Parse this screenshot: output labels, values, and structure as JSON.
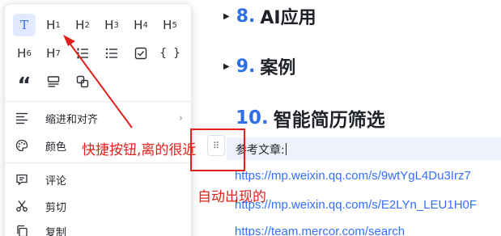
{
  "document": {
    "headings": [
      {
        "num": "8.",
        "text": "AI应用"
      },
      {
        "num": "9.",
        "text": "案例"
      },
      {
        "num": "10.",
        "text": "智能简历筛选"
      }
    ],
    "ref_label": "参考文章:",
    "links": [
      "https://mp.weixin.qq.com/s/9wtYgL4Du3Irz7",
      "https://mp.weixin.qq.com/s/E2LYn_LEU1H0F",
      "https://team.mercor.com/search"
    ]
  },
  "menu": {
    "row1": [
      {
        "label": "T",
        "sub": "",
        "icon": "text-icon"
      },
      {
        "label": "H",
        "sub": "1"
      },
      {
        "label": "H",
        "sub": "2"
      },
      {
        "label": "H",
        "sub": "3"
      },
      {
        "label": "H",
        "sub": "4"
      },
      {
        "label": "H",
        "sub": "5"
      }
    ],
    "row2": [
      {
        "label": "H",
        "sub": "6"
      },
      {
        "label": "H",
        "sub": "7"
      }
    ],
    "row2_icons": [
      "ordered-list-icon",
      "bullet-list-icon",
      "checkbox-icon",
      "code-braces-icon"
    ],
    "row2_glyphs": {
      "code": "{ }"
    },
    "row3_glyphs": {
      "quote": "“"
    },
    "items": {
      "indent": "缩进和对齐",
      "color": "颜色",
      "comment": "评论",
      "cut": "剪切",
      "copy": "复制"
    },
    "chevron": "›"
  },
  "handle": {
    "glyph": "⠿"
  },
  "annotations": {
    "shortcut": "快捷按钮,离的很近",
    "auto": "自动出现的",
    "color": "#e0211b"
  },
  "accent": "#3370ff"
}
